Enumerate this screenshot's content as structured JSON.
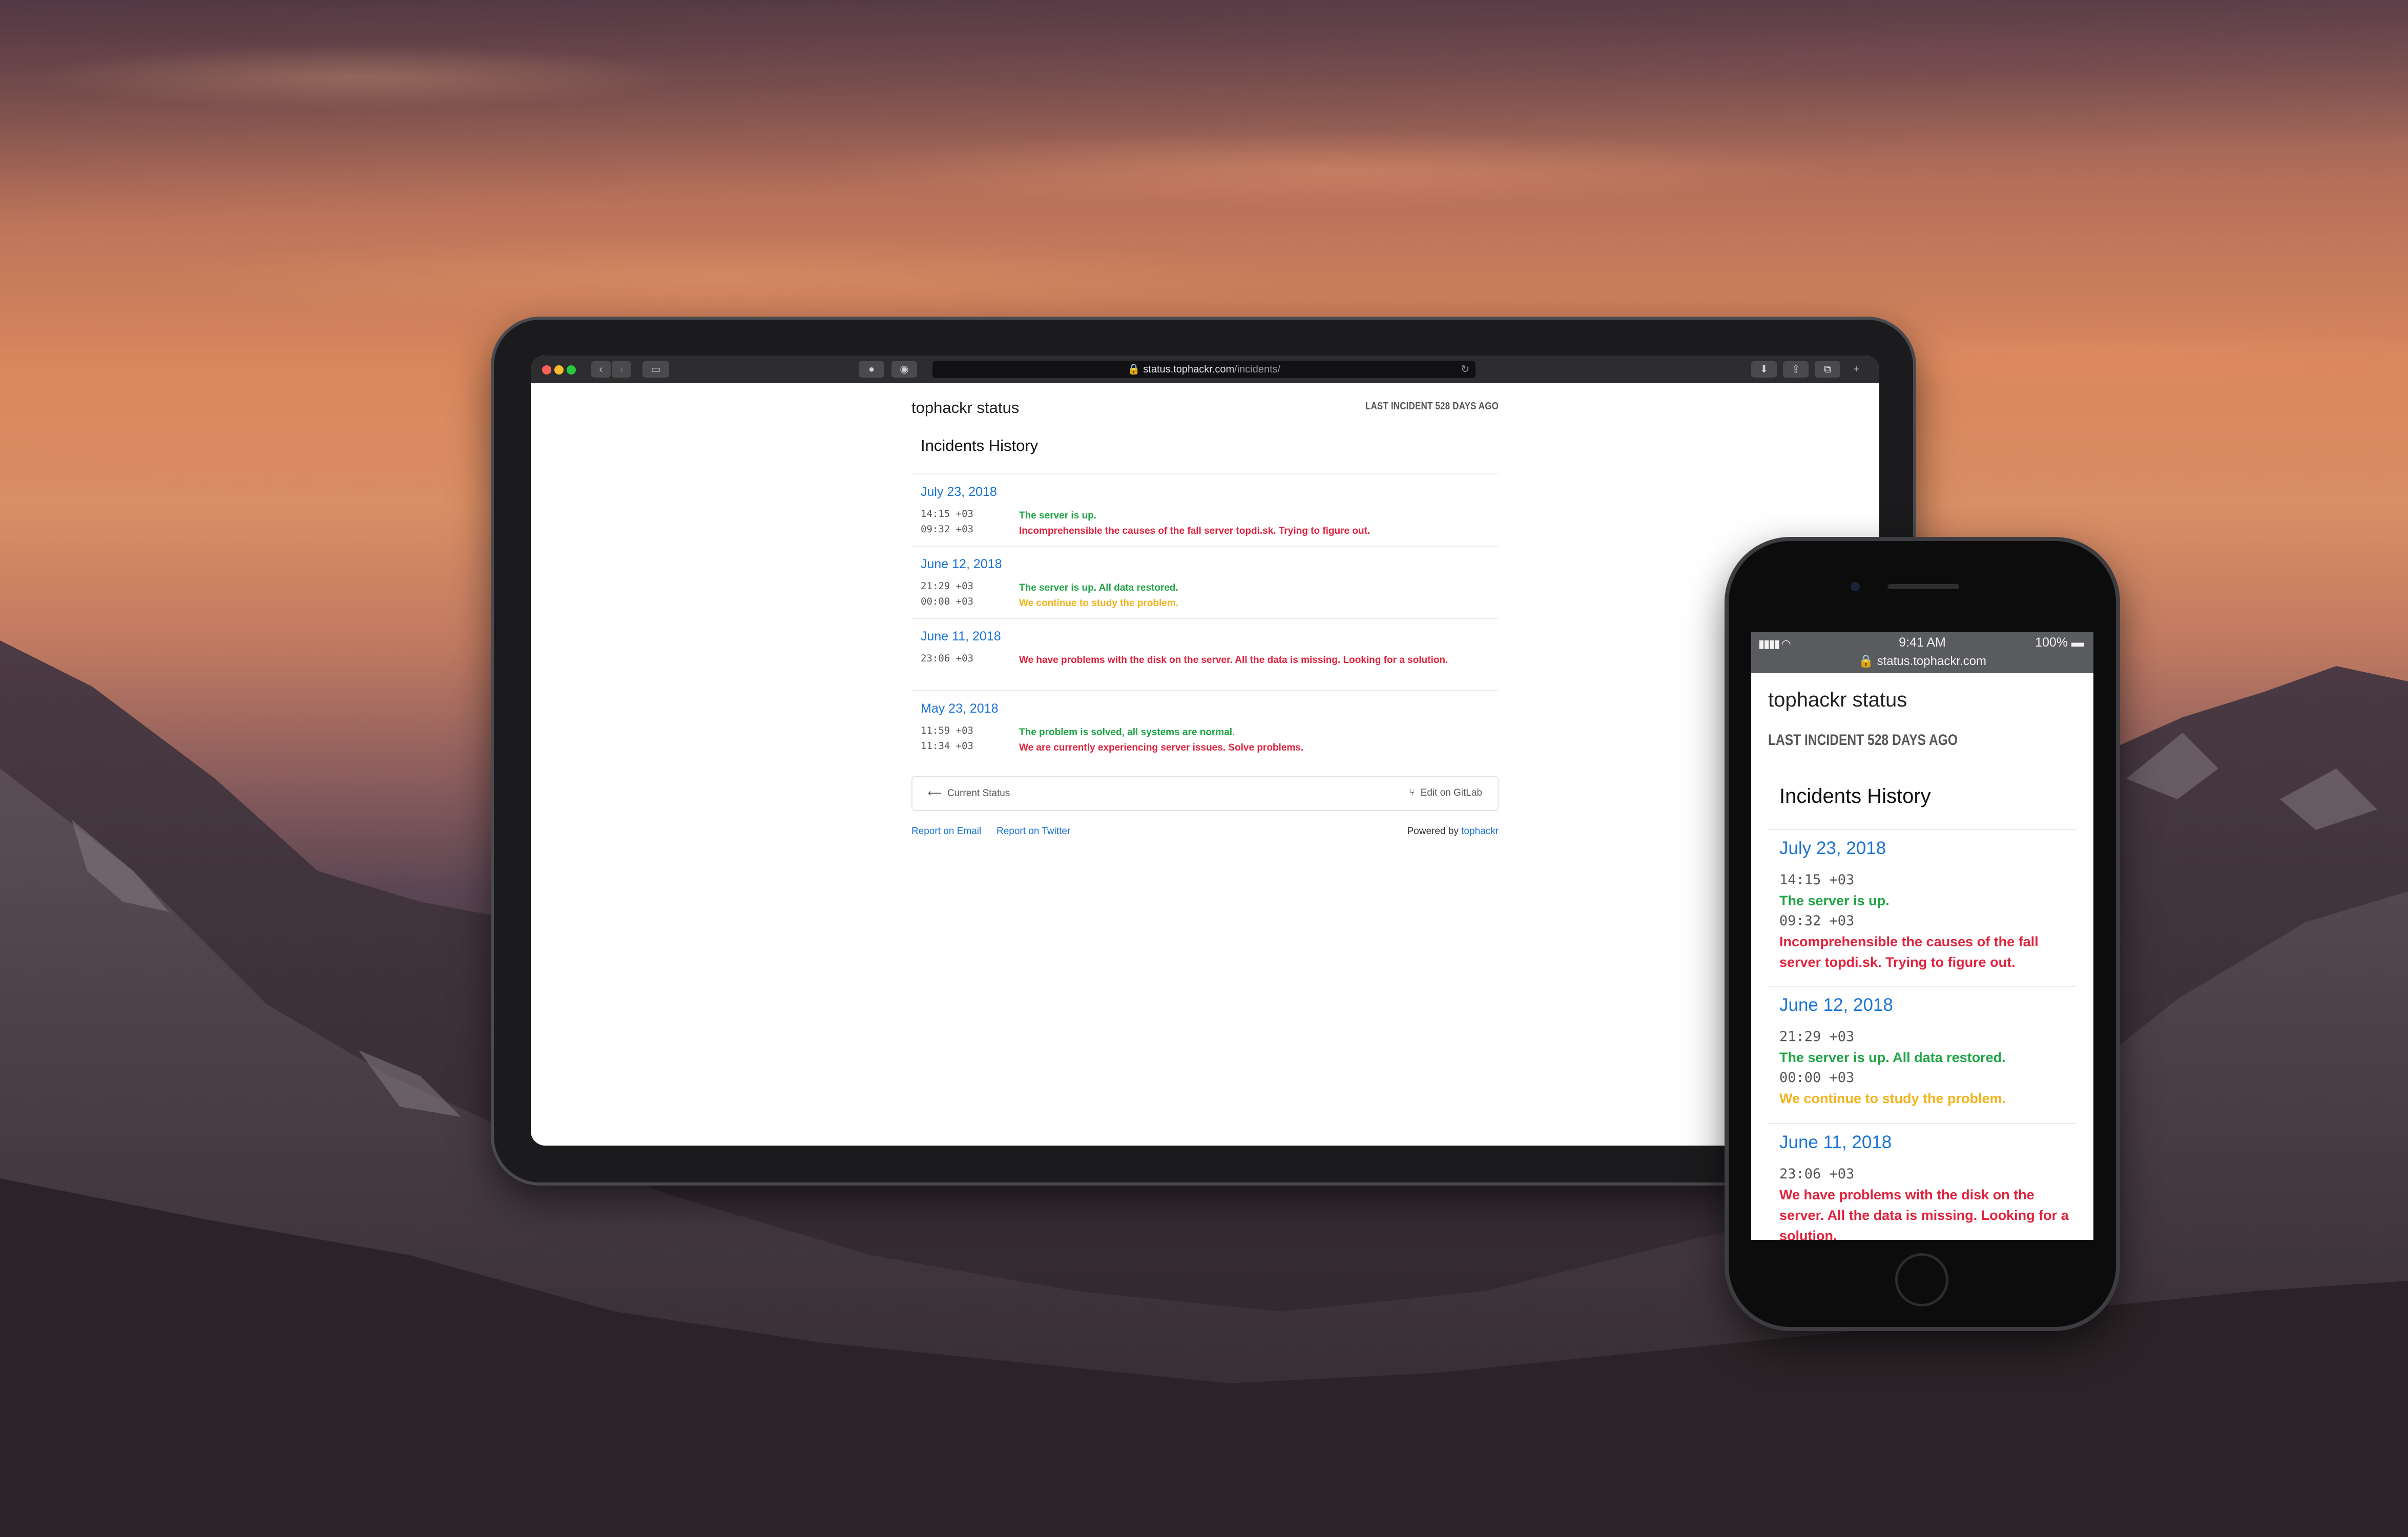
{
  "site": {
    "title": "tophackr status",
    "last_incident": "LAST INCIDENT 528 DAYS AGO",
    "history_title": "Incidents History"
  },
  "browser": {
    "url_host": "status.tophackr.com",
    "url_path": "/incidents/"
  },
  "days": [
    {
      "date": "July 23, 2018",
      "entries": [
        {
          "time": "14:15 +03",
          "message": "The server is up.",
          "status": "up"
        },
        {
          "time": "09:32 +03",
          "message": "Incomprehensible the causes of the fall server topdi.sk. Trying to figure out.",
          "status": "down"
        }
      ]
    },
    {
      "date": "June 12, 2018",
      "entries": [
        {
          "time": "21:29 +03",
          "message": "The server is up. All data restored.",
          "status": "up"
        },
        {
          "time": "00:00 +03",
          "message": "We continue to study the problem.",
          "status": "investigating"
        }
      ]
    },
    {
      "date": "June 11, 2018",
      "entries": [
        {
          "time": "23:06 +03",
          "message": "We have problems with the disk on the server. All the data is missing. Looking for a solution.",
          "status": "down"
        }
      ]
    },
    {
      "date": "May 23, 2018",
      "entries": [
        {
          "time": "11:59 +03",
          "message": "The problem is solved, all systems are normal.",
          "status": "up"
        },
        {
          "time": "11:34 +03",
          "message": "We are currently experiencing server issues. Solve problems.",
          "status": "down"
        }
      ]
    }
  ],
  "nav": {
    "current_status": "Current Status",
    "edit_on_gitlab": "Edit on GitLab"
  },
  "footer": {
    "report_email": "Report on Email",
    "report_twitter": "Report on Twitter",
    "powered_by": "Powered by",
    "powered_link": "tophackr"
  },
  "phone": {
    "time": "9:41 AM",
    "battery": "100%",
    "url": "status.tophackr.com",
    "partial_last_line": "for a solution."
  },
  "colors": {
    "link": "#1a73d6",
    "status_up": "#21a546",
    "status_down": "#e0233d",
    "status_investigating": "#f3b31d"
  }
}
